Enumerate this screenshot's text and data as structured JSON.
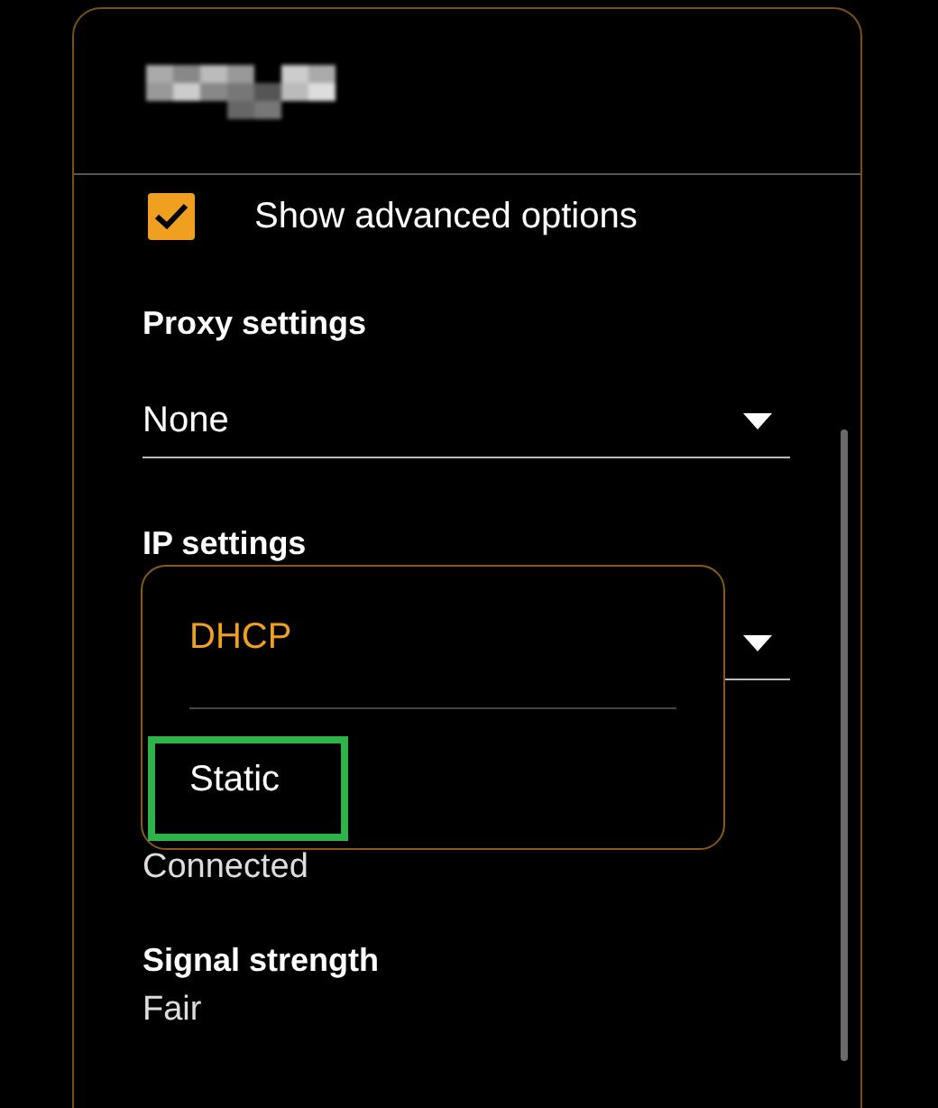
{
  "advanced": {
    "label": "Show advanced options",
    "checked": true
  },
  "proxy": {
    "label": "Proxy settings",
    "value": "None"
  },
  "ip": {
    "label": "IP settings",
    "menu": [
      {
        "label": "DHCP",
        "selected": true
      },
      {
        "label": "Static",
        "selected": false
      }
    ]
  },
  "status": "Connected",
  "signal": {
    "label": "Signal strength",
    "value": "Fair"
  }
}
